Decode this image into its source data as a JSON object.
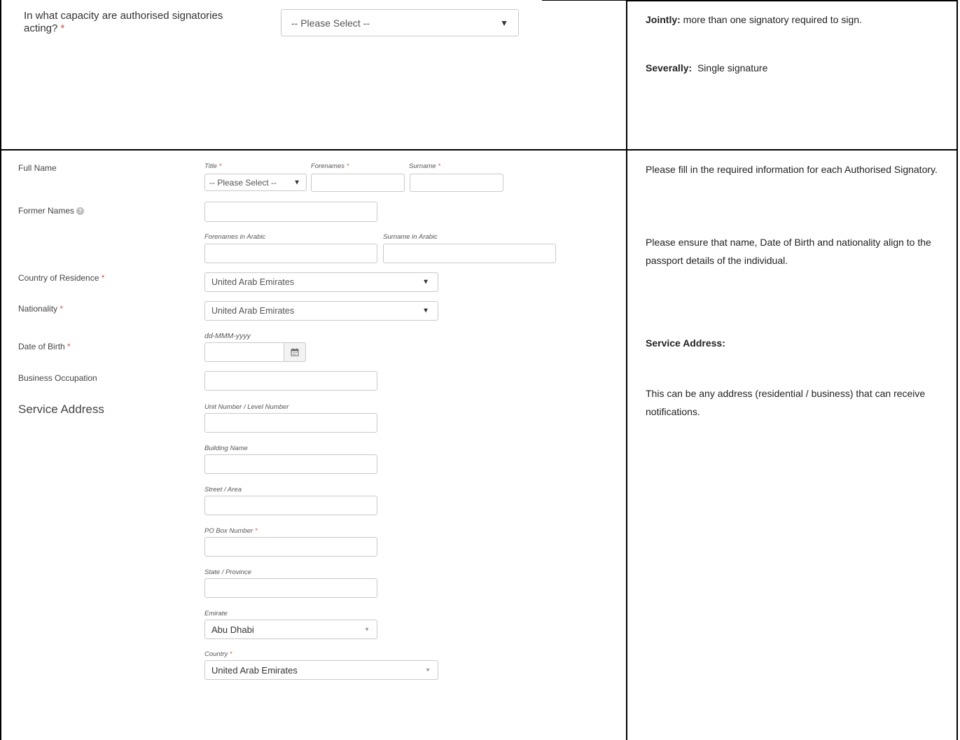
{
  "top": {
    "question": "In what capacity are authorised signatories acting?",
    "required_mark": "*",
    "capacity_select": "-- Please Select --",
    "help_jointly_label": "Jointly:",
    "help_jointly_text": "more than one signatory required to sign.",
    "help_severally_label": "Severally:",
    "help_severally_text": "Single signature"
  },
  "form": {
    "full_name_label": "Full Name",
    "title_caption": "Title",
    "forenames_caption": "Forenames",
    "surname_caption": "Surname",
    "title_select": "-- Please Select --",
    "former_names_label": "Former Names",
    "forenames_arabic_caption": "Forenames in Arabic",
    "surname_arabic_caption": "Surname in Arabic",
    "country_residence_label": "Country of Residence",
    "country_residence_value": "United Arab Emirates",
    "nationality_label": "Nationality",
    "nationality_value": "United Arab Emirates",
    "dob_format": "dd-MMM-yyyy",
    "dob_label": "Date of Birth",
    "business_occupation_label": "Business Occupation",
    "service_address_heading": "Service Address",
    "unit_caption": "Unit Number / Level Number",
    "building_caption": "Building Name",
    "street_caption": "Street / Area",
    "po_box_caption": "PO Box Number",
    "state_caption": "State / Province",
    "emirate_caption": "Emirate",
    "emirate_value": "Abu Dhabi",
    "country_caption": "Country",
    "country_value": "United Arab Emirates"
  },
  "help": {
    "p1": "Please fill in the required information for each Authorised Signatory.",
    "p2": "Please ensure that name, Date of Birth and nationality align to the passport details of the individual.",
    "service_heading": "Service Address:",
    "p3": "This can be any address (residential / business) that can receive notifications."
  },
  "icons": {
    "dropdown": "triangle-down",
    "calendar": "calendar-icon",
    "help": "question-circle-icon"
  }
}
